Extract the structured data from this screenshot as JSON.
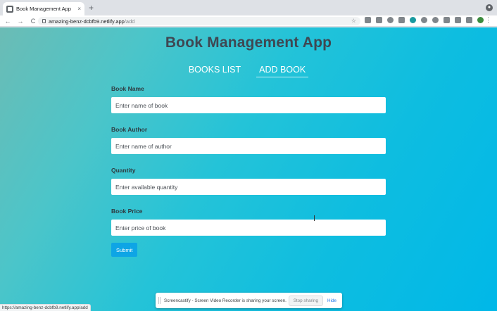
{
  "browser": {
    "tab_title": "Book Management App",
    "tab_close": "×",
    "new_tab": "+",
    "url_host": "amazing-benz-dcbfb9.netlify.app",
    "url_path": "/add",
    "status_url": "https://amazing-benz-dcbfb9.netlify.app/add",
    "back": "←",
    "forward": "→",
    "reload": "C",
    "star": "☆",
    "menu": "⋮",
    "profile_glyph": "●"
  },
  "app": {
    "title": "Book Management App",
    "nav": [
      {
        "label": "BOOKS LIST",
        "active": false
      },
      {
        "label": "ADD BOOK",
        "active": true
      }
    ]
  },
  "form": {
    "fields": [
      {
        "label": "Book Name",
        "placeholder": "Enter name of book"
      },
      {
        "label": "Book Author",
        "placeholder": "Enter name of author"
      },
      {
        "label": "Quantity",
        "placeholder": "Enter available quantity"
      },
      {
        "label": "Book Price",
        "placeholder": "Enter price of book"
      }
    ],
    "submit_label": "Submit"
  },
  "share_bar": {
    "message": "Screencastify - Screen Video Recorder is sharing your screen.",
    "stop_label": "Stop sharing",
    "hide_label": "Hide"
  },
  "colors": {
    "accent": "#0ea5e5",
    "title_text": "#3f4752"
  }
}
